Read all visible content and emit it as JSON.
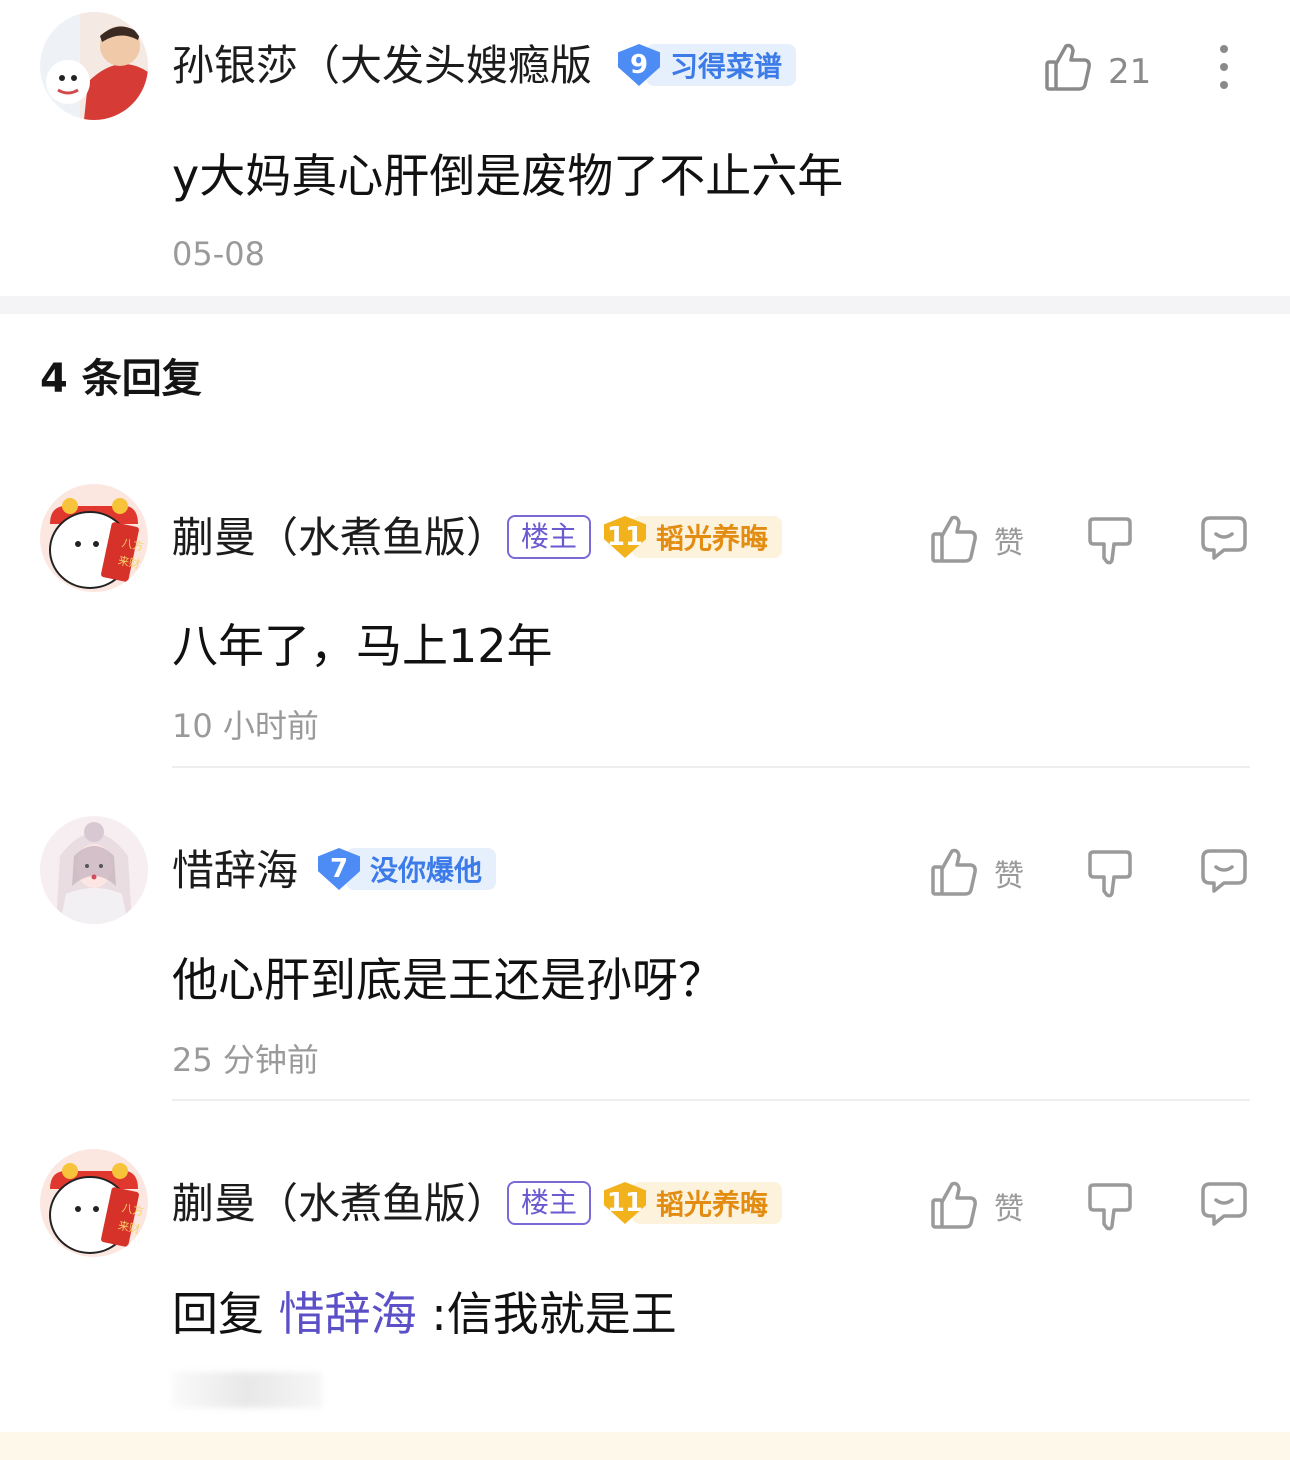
{
  "top_comment": {
    "author": "孙银莎（大发头嫂瘾版",
    "badge": {
      "level": "9",
      "title": "习得菜谱"
    },
    "likes": "21",
    "text": "y大妈真心肝倒是废物了不止六年",
    "time": "05-08"
  },
  "replies_header": "4 条回复",
  "replies": [
    {
      "author": "蒯曼（水煮鱼版）",
      "owner_tag": "楼主",
      "badge": {
        "level": "11",
        "title": "韬光养晦"
      },
      "like_label": "赞",
      "text": "八年了，马上12年",
      "time": "10 小时前"
    },
    {
      "author": "惜辞海",
      "badge": {
        "level": "7",
        "title": "没你爆他"
      },
      "like_label": "赞",
      "text": "他心肝到底是王还是孙呀？",
      "time": "25 分钟前"
    },
    {
      "author": "蒯曼（水煮鱼版）",
      "owner_tag": "楼主",
      "badge": {
        "level": "11",
        "title": "韬光养晦"
      },
      "like_label": "赞",
      "reply_prefix": "回复",
      "reply_to": "惜辞海",
      "text": ":信我就是王"
    }
  ],
  "icons": {
    "like": "thumb-up-icon",
    "dislike": "thumb-down-icon",
    "reply": "comment-bubble-icon",
    "more": "more-vertical-icon"
  },
  "colors": {
    "badge_blue": "#4d8bf5",
    "badge_gold": "#f2b21c",
    "owner_tag": "#6a5ad0",
    "mention": "#5b50c8"
  }
}
